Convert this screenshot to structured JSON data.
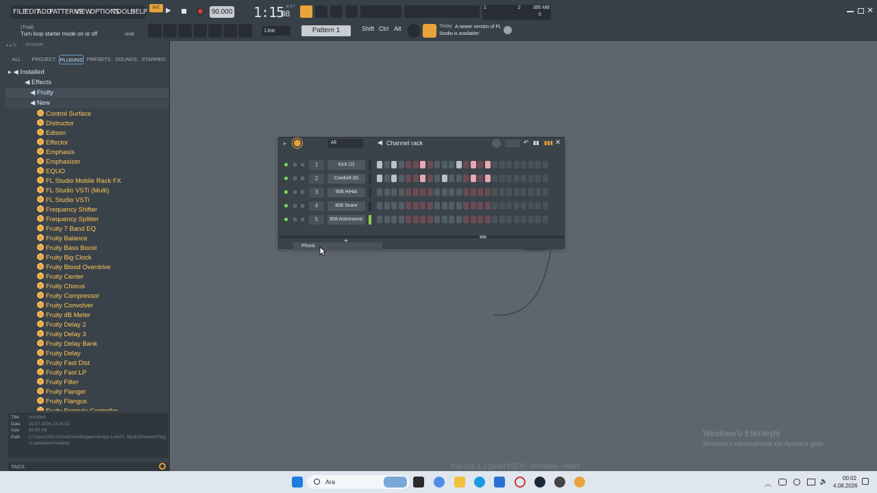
{
  "menu": [
    "FILE",
    "EDIT",
    "ADD",
    "PATTERNS",
    "VIEW",
    "OPTIONS",
    "TOOLS",
    "HELP"
  ],
  "transport": {
    "pat_label": "PAT",
    "tempo": "90.000",
    "time": "1:15",
    "time_small": "08",
    "time_meta": "B:S:T"
  },
  "cpu": {
    "num1": "1",
    "num2": "2",
    "mem": "395 MB",
    "num3": "0"
  },
  "hint": {
    "trial": "(Trial)",
    "text": "Turn loop starter mode on or off",
    "shortcut": "shift"
  },
  "snap": "Line",
  "pattern": "Pattern 1",
  "keys": [
    "Shift",
    "Ctrl",
    "Alt"
  ],
  "news": {
    "when": "Today",
    "text": "A newer version of FL Studio is available!"
  },
  "browser": {
    "title": "Browser",
    "tabs": [
      "ALL",
      "PROJECT",
      "PLUGINS",
      "PRESETS",
      "SOUNDS",
      "STARRED"
    ],
    "tree": {
      "installed": "Installed",
      "effects": "Effects",
      "fruity": "Fruity",
      "new": "New"
    },
    "plugins": [
      "Control Surface",
      "Distructor",
      "Edison",
      "Effector",
      "Emphasis",
      "Emphasizer",
      "EQUO",
      "FL Studio Mobile Rack FX",
      "FL Studio VSTi (Multi)",
      "FL Studio VSTi",
      "Frequency Shifter",
      "Frequency Splitter",
      "Fruity 7 Band EQ",
      "Fruity Balance",
      "Fruity Bass Boost",
      "Fruity Big Clock",
      "Fruity Blood Overdrive",
      "Fruity Center",
      "Fruity Chorus",
      "Fruity Compressor",
      "Fruity Convolver",
      "Fruity dB Meter",
      "Fruity Delay 2",
      "Fruity Delay 3",
      "Fruity Delay Bank",
      "Fruity Delay",
      "Fruity Fast Dist",
      "Fruity Fast LP",
      "Fruity Filter",
      "Fruity Flanger",
      "Fruity Flangus",
      "Fruity Formula Controller"
    ],
    "info": {
      "title_k": "Title",
      "title_v": "Installed",
      "date_k": "Date",
      "date_v": "20.07.2026 23:28:52",
      "size_k": "Size",
      "size_v": "65.90 KB",
      "path_k": "Path",
      "path_v": "C:\\Users\\3Str3\\OneDrive\\Belgeler\\Image-Line\\FL Studio\\Presets\\Plugin database\\Installed"
    },
    "tags": "TAGS"
  },
  "rack": {
    "filter": "All",
    "title": "Channel rack",
    "channels": [
      {
        "n": "1",
        "name": "Kick (2)",
        "steps": [
          1,
          0,
          1,
          0,
          0,
          0,
          1,
          0,
          0,
          0,
          0,
          1,
          0,
          1,
          0,
          1
        ]
      },
      {
        "n": "2",
        "name": "Cowbell (8)",
        "steps": [
          1,
          0,
          1,
          0,
          0,
          0,
          1,
          0,
          0,
          1,
          0,
          0,
          0,
          1,
          0,
          1
        ]
      },
      {
        "n": "3",
        "name": "808 HiHat",
        "steps": [
          0,
          0,
          0,
          0,
          0,
          0,
          0,
          0,
          0,
          0,
          0,
          0,
          0,
          0,
          0,
          0
        ]
      },
      {
        "n": "4",
        "name": "808 Snare",
        "steps": [
          0,
          0,
          0,
          0,
          0,
          0,
          0,
          0,
          0,
          0,
          0,
          0,
          0,
          0,
          0,
          0
        ]
      },
      {
        "n": "5",
        "name": "808 Astronomic",
        "steps": [
          0,
          0,
          0,
          0,
          0,
          0,
          0,
          0,
          0,
          0,
          0,
          0,
          0,
          0,
          0,
          0
        ]
      }
    ],
    "group": "Phonk",
    "add": "+"
  },
  "watermark": {
    "title": "Windows'u Etkinleştir",
    "sub": "Windows'u etkinleştirmek için Ayarlar'a gidin."
  },
  "build": "Trial v26.1.2 [build 5557] - Windows - 64Bit",
  "taskbar": {
    "search": "Ara",
    "time": "00:02",
    "date": "4.08.2026"
  },
  "colors": {
    "accent": "#ffc75a",
    "pad_on": "#b8c0c8",
    "pad_on_red": "#e8a7b2"
  }
}
